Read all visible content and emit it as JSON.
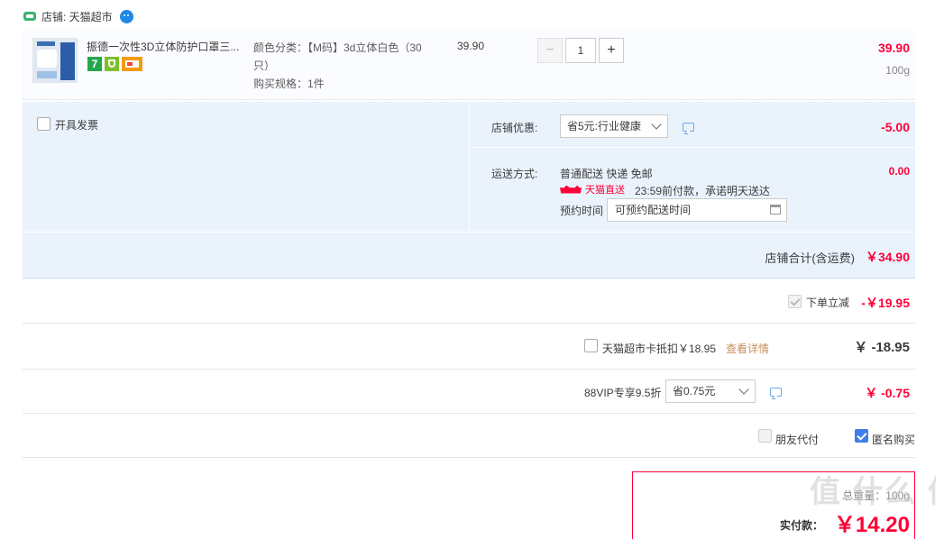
{
  "shop": {
    "label": "店铺: 天猫超市"
  },
  "item": {
    "title": "振德一次性3D立体防护口罩三...",
    "sku_label": "颜色分类：",
    "sku_value": "【M码】3d立体白色（30只）",
    "spec": "购买规格：1件",
    "unit_price": "39.90",
    "quantity": "1",
    "total": "39.90",
    "weight": "100g"
  },
  "invoice": {
    "label": "开具发票"
  },
  "shop_discount": {
    "label": "店铺优惠:",
    "selected": "省5元:行业健康",
    "amount": "-5.00"
  },
  "shipping": {
    "label": "运送方式:",
    "method": "普通配送 快递 免邮",
    "amount": "0.00",
    "badge": "天猫直送",
    "promise": "23:59前付款，承诺明天送达",
    "schedule_label": "预约时间",
    "schedule_value": "可预约配送时间"
  },
  "shop_total": {
    "label": "店铺合计(含运费)",
    "amount": "￥34.90"
  },
  "instant_discount": {
    "label": "下单立减",
    "amount": "-￥19.95"
  },
  "supermarket_card": {
    "label": "天猫超市卡抵扣￥18.95",
    "details_link": "查看详情",
    "amount": "￥ -18.95"
  },
  "vip": {
    "label": "88VIP专享9.5折",
    "selected": "省0.75元",
    "amount": "￥ -0.75"
  },
  "options": {
    "friend_pay": "朋友代付",
    "anonymous": "匿名购买"
  },
  "summary": {
    "weight": "总重量：100g",
    "pay_label": "实付款：",
    "pay_amount": "￥14.20"
  },
  "watermark": "值 什么 值得买",
  "colors": {
    "accent_red": "#ff0036",
    "panel_blue": "#eaf3fc",
    "link_orange": "#c58f5a"
  }
}
